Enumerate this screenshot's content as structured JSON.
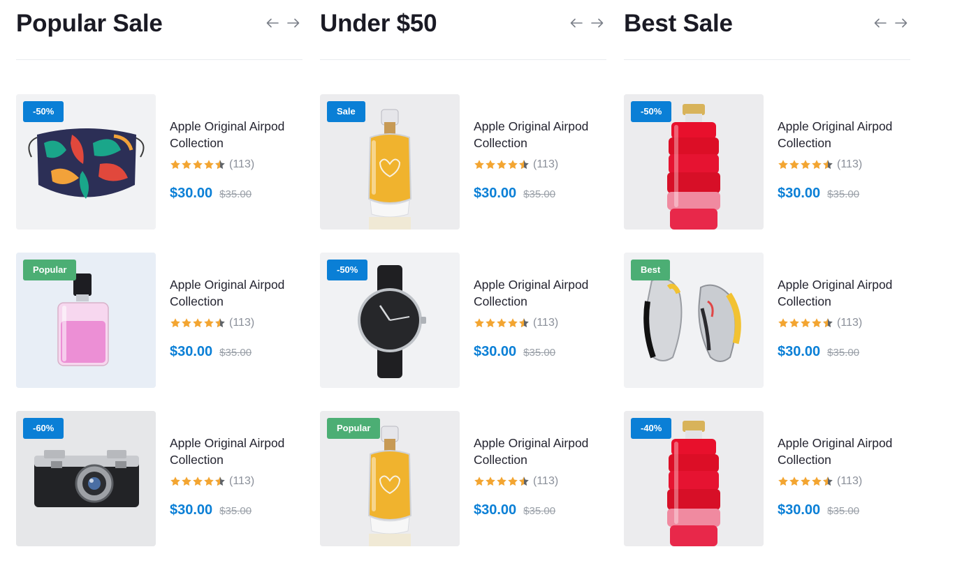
{
  "colors": {
    "accent": "#0a7fd6",
    "badge_blue": "#0a7fd6",
    "badge_green": "#4cae74",
    "star": "#f3a531"
  },
  "columns": [
    {
      "title": "Popular Sale",
      "items": [
        {
          "badge": "-50%",
          "badge_color": "blue",
          "image": "face-mask",
          "name": "Apple Original Airpod Collection",
          "rating_count": "(113)",
          "price": "$30.00",
          "old_price": "$35.00"
        },
        {
          "badge": "Popular",
          "badge_color": "green",
          "image": "pink-perfume",
          "name": "Apple Original Airpod Collection",
          "rating_count": "(113)",
          "price": "$30.00",
          "old_price": "$35.00"
        },
        {
          "badge": "-60%",
          "badge_color": "blue",
          "image": "camera",
          "name": "Apple Original Airpod Collection",
          "rating_count": "(113)",
          "price": "$30.00",
          "old_price": "$35.00"
        }
      ]
    },
    {
      "title": "Under $50",
      "items": [
        {
          "badge": "Sale",
          "badge_color": "blue",
          "image": "gold-perfume",
          "name": "Apple Original Airpod Collection",
          "rating_count": "(113)",
          "price": "$30.00",
          "old_price": "$35.00"
        },
        {
          "badge": "-50%",
          "badge_color": "blue",
          "image": "wristwatch",
          "name": "Apple Original Airpod Collection",
          "rating_count": "(113)",
          "price": "$30.00",
          "old_price": "$35.00"
        },
        {
          "badge": "Popular",
          "badge_color": "green",
          "image": "gold-perfume",
          "name": "Apple Original Airpod Collection",
          "rating_count": "(113)",
          "price": "$30.00",
          "old_price": "$35.00"
        }
      ]
    },
    {
      "title": "Best Sale",
      "items": [
        {
          "badge": "-50%",
          "badge_color": "blue",
          "image": "red-perfume",
          "name": "Apple Original Airpod Collection",
          "rating_count": "(113)",
          "price": "$30.00",
          "old_price": "$35.00"
        },
        {
          "badge": "Best",
          "badge_color": "green",
          "image": "sneakers",
          "name": "Apple Original Airpod Collection",
          "rating_count": "(113)",
          "price": "$30.00",
          "old_price": "$35.00"
        },
        {
          "badge": "-40%",
          "badge_color": "blue",
          "image": "red-perfume",
          "name": "Apple Original Airpod Collection",
          "rating_count": "(113)",
          "price": "$30.00",
          "old_price": "$35.00"
        }
      ]
    }
  ],
  "rating_stars": 4.5
}
